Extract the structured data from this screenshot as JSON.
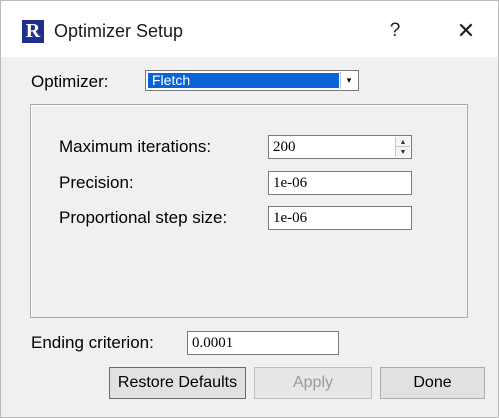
{
  "window": {
    "title": "Optimizer Setup",
    "app_icon_letter": "R",
    "help_glyph": "?",
    "close_glyph": "✕"
  },
  "optimizer": {
    "label": "Optimizer:",
    "selected": "Fletch",
    "arrow_glyph": "▾"
  },
  "settings": {
    "max_iterations": {
      "label": "Maximum iterations:",
      "value": "200"
    },
    "precision": {
      "label": "Precision:",
      "value": "1e-06"
    },
    "step_size": {
      "label": "Proportional step size:",
      "value": "1e-06"
    }
  },
  "ending": {
    "label": "Ending criterion:",
    "value": "0.0001"
  },
  "buttons": {
    "restore": "Restore Defaults",
    "apply": "Apply",
    "done": "Done"
  }
}
